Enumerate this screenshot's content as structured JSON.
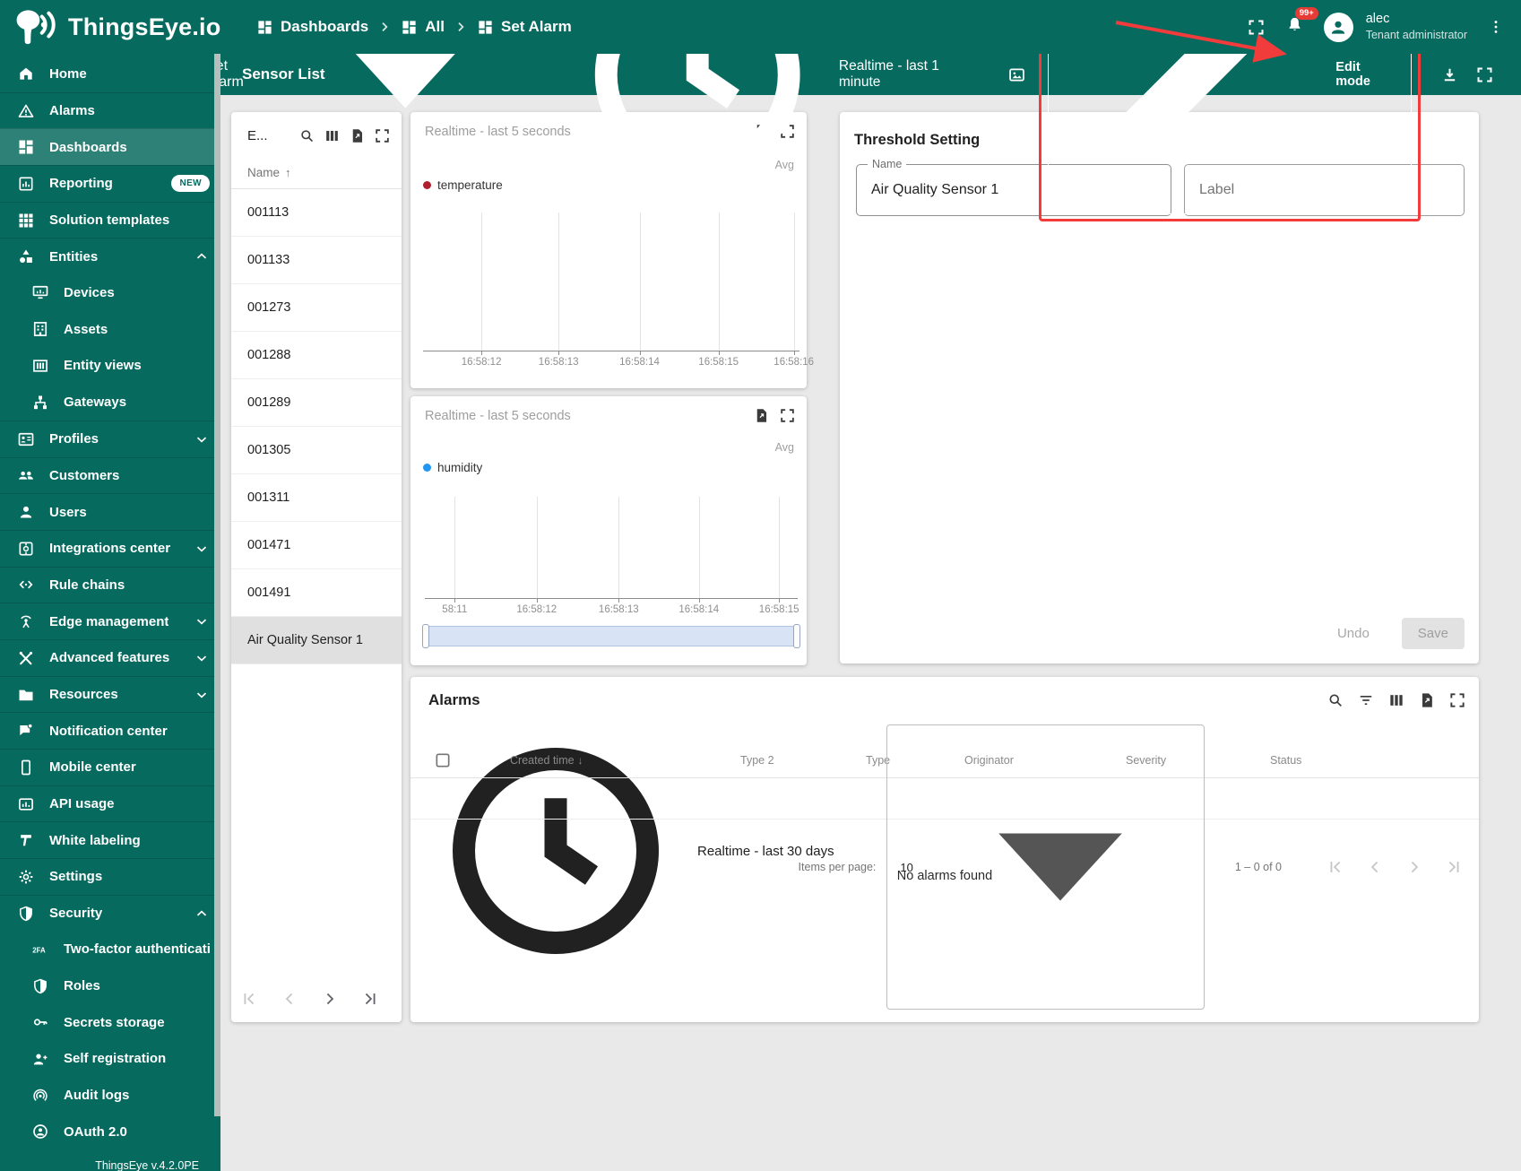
{
  "colors": {
    "teal": "#066a5f",
    "teal_selected": "#2e8177",
    "content_bg": "#e9e9e9",
    "annotation_red": "#f23b3b",
    "badge_red": "#e63c35",
    "temperature_series": "#b01f2e",
    "humidity_series": "#2196f3"
  },
  "header": {
    "logo_text": "ThingsEye.io",
    "breadcrumbs": [
      {
        "label": "Dashboards",
        "icon": "dashboards-icon"
      },
      {
        "label": "All",
        "icon": "dashboards-icon"
      },
      {
        "label": "Set Alarm",
        "icon": "dashboards-icon"
      }
    ],
    "notification_badge": "99+",
    "user": {
      "name": "alec",
      "role": "Tenant administrator"
    }
  },
  "sidebar": {
    "items": [
      {
        "label": "Home",
        "icon": "home-icon"
      },
      {
        "label": "Alarms",
        "icon": "alarm-warning-icon"
      },
      {
        "label": "Dashboards",
        "icon": "dashboards-icon",
        "selected": true
      },
      {
        "label": "Reporting",
        "icon": "reporting-icon",
        "badge": "NEW"
      },
      {
        "label": "Solution templates",
        "icon": "solution-templates-icon"
      },
      {
        "label": "Entities",
        "icon": "entities-icon",
        "expand": "up"
      },
      {
        "label": "Devices",
        "icon": "devices-icon",
        "child": true
      },
      {
        "label": "Assets",
        "icon": "assets-icon",
        "child": true
      },
      {
        "label": "Entity views",
        "icon": "entity-views-icon",
        "child": true
      },
      {
        "label": "Gateways",
        "icon": "gateways-icon",
        "child": true
      },
      {
        "label": "Profiles",
        "icon": "profiles-icon",
        "expand": "down"
      },
      {
        "label": "Customers",
        "icon": "customers-icon"
      },
      {
        "label": "Users",
        "icon": "users-icon"
      },
      {
        "label": "Integrations center",
        "icon": "integrations-icon",
        "expand": "down"
      },
      {
        "label": "Rule chains",
        "icon": "rule-chains-icon"
      },
      {
        "label": "Edge management",
        "icon": "edge-management-icon",
        "expand": "down"
      },
      {
        "label": "Advanced features",
        "icon": "advanced-features-icon",
        "expand": "down"
      },
      {
        "label": "Resources",
        "icon": "resources-icon",
        "expand": "down"
      },
      {
        "label": "Notification center",
        "icon": "notification-center-icon"
      },
      {
        "label": "Mobile center",
        "icon": "mobile-center-icon"
      },
      {
        "label": "API usage",
        "icon": "api-usage-icon"
      },
      {
        "label": "White labeling",
        "icon": "white-labeling-icon"
      },
      {
        "label": "Settings",
        "icon": "settings-gear-icon"
      },
      {
        "label": "Security",
        "icon": "security-shield-icon",
        "expand": "up"
      },
      {
        "label": "Two-factor authenticati…",
        "icon": "two-factor-icon",
        "child": true
      },
      {
        "label": "Roles",
        "icon": "roles-shield-icon",
        "child": true
      },
      {
        "label": "Secrets storage",
        "icon": "secrets-key-icon",
        "child": true
      },
      {
        "label": "Self registration",
        "icon": "self-registration-icon",
        "child": true
      },
      {
        "label": "Audit logs",
        "icon": "audit-logs-icon",
        "child": true
      },
      {
        "label": "OAuth 2.0",
        "icon": "oauth-icon",
        "child": true
      }
    ],
    "version": "ThingsEye v.4.2.0PE"
  },
  "toolbar": {
    "title": "Sensor List",
    "state_select": "Set Alarm",
    "timewindow": "Realtime - last 1 minute",
    "edit_button": "Edit mode"
  },
  "entity_list": {
    "title": "E...",
    "column": "Name",
    "rows": [
      "001113",
      "001133",
      "001273",
      "001288",
      "001289",
      "001305",
      "001311",
      "001471",
      "001491",
      "Air Quality Sensor 1"
    ],
    "selected_row": "Air Quality Sensor 1"
  },
  "chart_data": [
    {
      "type": "line",
      "title": "Realtime - last 5 seconds",
      "aggregation": "Avg",
      "series": [
        {
          "name": "temperature",
          "color": "#b01f2e",
          "x": [],
          "y": []
        }
      ],
      "x_ticks": [
        "16:58:12",
        "16:58:13",
        "16:58:14",
        "16:58:15",
        "16:58:16"
      ],
      "legend_position": "top-left",
      "grid": "vertical-only",
      "note": "no data points visible - empty realtime chart"
    },
    {
      "type": "line",
      "title": "Realtime - last 5 seconds",
      "aggregation": "Avg",
      "series": [
        {
          "name": "humidity",
          "color": "#2196f3",
          "x": [],
          "y": []
        }
      ],
      "x_ticks": [
        "58:11",
        "16:58:12",
        "16:58:13",
        "16:58:14",
        "16:58:15"
      ],
      "legend_position": "top-left",
      "grid": "vertical-only",
      "note": "no data points visible - empty realtime chart with data-zoom slider"
    }
  ],
  "threshold": {
    "title": "Threshold Setting",
    "name_label": "Name",
    "name_value": "Air Quality Sensor 1",
    "label_placeholder": "Label",
    "undo_label": "Undo",
    "save_label": "Save"
  },
  "alarms": {
    "title": "Alarms",
    "timewindow": "Realtime - last 30 days",
    "columns": [
      "Created time",
      "Type 2",
      "Type",
      "Originator",
      "Severity",
      "Status"
    ],
    "empty_text": "No alarms found",
    "items_per_page_label": "Items per page:",
    "items_per_page_value": "10",
    "range_label": "1 – 0 of 0"
  }
}
